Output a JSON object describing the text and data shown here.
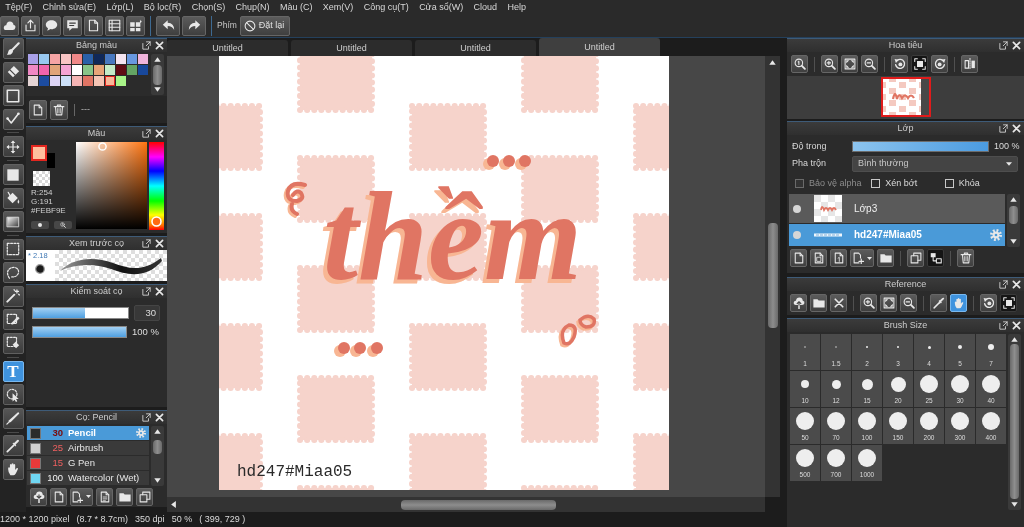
{
  "menu": [
    "Tệp(F)",
    "Chỉnh sửa(E)",
    "Lớp(L)",
    "Bộ lọc(R)",
    "Chọn(S)",
    "Chụp(N)",
    "Màu (C)",
    "Xem(V)",
    "Công cụ(T)",
    "Cửa sổ(W)",
    "Cloud",
    "Help"
  ],
  "toolbar": {
    "shortcut_label": "Phím",
    "reset_button": "Đặt lại"
  },
  "tools": [
    {
      "kind": "brush",
      "selected": false
    },
    {
      "kind": "eraser",
      "selected": false
    },
    {
      "kind": "shape",
      "selected": false
    },
    {
      "kind": "curve",
      "selected": false
    },
    {
      "kind": "move",
      "selected": false
    },
    {
      "kind": "fill",
      "selected": false
    },
    {
      "kind": "bucket",
      "selected": false
    },
    {
      "kind": "gradient",
      "selected": false
    },
    {
      "kind": "select",
      "selected": false
    },
    {
      "kind": "lasso",
      "selected": false
    },
    {
      "kind": "wand",
      "selected": false
    },
    {
      "kind": "select_pen",
      "selected": false
    },
    {
      "kind": "select_eraser",
      "selected": false
    },
    {
      "kind": "text",
      "glyph": "T",
      "selected": true
    },
    {
      "kind": "operation",
      "selected": false
    },
    {
      "kind": "divide",
      "selected": false
    },
    {
      "kind": "eyedropper",
      "selected": false
    },
    {
      "kind": "hand",
      "selected": false
    }
  ],
  "palette": {
    "title": "Bảng màu",
    "swatches": [
      {
        "color": "#a8a0e8",
        "selected": false
      },
      {
        "color": "#98c8f0",
        "selected": false
      },
      {
        "color": "#f4a4a4",
        "selected": false
      },
      {
        "color": "#f8c4c4",
        "selected": false
      },
      {
        "color": "#f08888",
        "selected": false
      },
      {
        "color": "#2a60a8",
        "selected": false
      },
      {
        "color": "#102858",
        "selected": false
      },
      {
        "color": "#4878c0",
        "selected": false
      },
      {
        "color": "#f4e4f0",
        "selected": false
      },
      {
        "color": "#6898e0",
        "selected": false
      },
      {
        "color": "#f0b4dc",
        "selected": false
      },
      {
        "color": "#f088c4",
        "selected": false
      },
      {
        "color": "#f064ac",
        "selected": false
      },
      {
        "color": "#e0a478",
        "selected": false
      },
      {
        "color": "#f4a4d4",
        "selected": false
      },
      {
        "color": "#ffffff",
        "selected": false
      },
      {
        "color": "#88c488",
        "selected": false
      },
      {
        "color": "#e8a478",
        "selected": false
      },
      {
        "color": "#c4ecc8",
        "selected": false
      },
      {
        "color": "#600c14",
        "selected": false
      },
      {
        "color": "#64a464",
        "selected": false
      },
      {
        "color": "#18489c",
        "selected": false
      },
      {
        "color": "#e4d4d4",
        "selected": false
      },
      {
        "color": "#1c4ca0",
        "selected": false
      },
      {
        "color": "#dcd4f4",
        "selected": false
      },
      {
        "color": "#cce0f8",
        "selected": false
      },
      {
        "color": "#f4b4b4",
        "selected": false
      },
      {
        "color": "#e07464",
        "selected": false
      },
      {
        "color": "#f4c4b4",
        "selected": false
      },
      {
        "color": "#f8b898",
        "selected": true
      },
      {
        "color": "#a8f488",
        "selected": false
      }
    ],
    "name": "---"
  },
  "color": {
    "title": "Màu",
    "current": [
      {
        "kind": "foreground",
        "color": "#febf9e",
        "selected": true
      },
      {
        "kind": "background",
        "color": "#000000",
        "selected": false
      }
    ],
    "r": "R:254",
    "g": "G:191",
    "hex": "#FEBF9E",
    "hue": {
      "level": 0.97
    }
  },
  "brush_preview": {
    "title": "Xem trước cọ",
    "size": "* 2.18"
  },
  "brush_control": {
    "title": "Kiểm soát cọ",
    "size": {
      "level": 0.55,
      "value": "30"
    },
    "opacity": {
      "level": 1,
      "reading": "100 %"
    }
  },
  "brushes": {
    "title": "Cọ: Pencil",
    "items": [
      {
        "color": "#2b2b2b",
        "size": "30",
        "size_accent": true,
        "name": "Pencil",
        "selected": true
      },
      {
        "color": "#d0d0d0",
        "size": "25",
        "size_accent": true,
        "name": "Airbrush",
        "selected": false
      },
      {
        "color": "#e83a3a",
        "size": "15",
        "size_accent": true,
        "name": "G Pen",
        "selected": false
      },
      {
        "color": "#6fd6f2",
        "size": "100",
        "size_accent": false,
        "name": "Watercolor (Wet)",
        "selected": false
      }
    ]
  },
  "document_tabs": [
    {
      "title": "Untitled",
      "selected": false
    },
    {
      "title": "Untitled",
      "selected": false
    },
    {
      "title": "Untitled",
      "selected": false
    },
    {
      "title": "Untitled",
      "selected": true
    }
  ],
  "canvas": {
    "lettering": "thềm",
    "signature": "hd247#Miaa05"
  },
  "status_bar": {
    "image_size": "1200 * 1200 pixel",
    "print_size": "(8.7 * 8.7cm)",
    "resolution": "350 dpi",
    "zoom": "50 %",
    "cursor": "( 399, 729 )"
  },
  "navigator": {
    "title": "Hoa tiêu",
    "buttons": [
      {
        "kind": "zoom_reset",
        "pressed": false
      },
      {
        "kind": "zoom_in",
        "pressed": false
      },
      {
        "kind": "fit",
        "pressed": false
      },
      {
        "kind": "zoom_out",
        "pressed": false
      },
      {
        "kind": "rotate_left",
        "pressed": false
      },
      {
        "kind": "actual_size",
        "pressed": true
      },
      {
        "kind": "rotate_right",
        "pressed": false
      },
      {
        "kind": "flip",
        "pressed": false
      }
    ]
  },
  "layers": {
    "title": "Lớp",
    "opacity": {
      "label": "Độ trong",
      "level": 1,
      "reading": "100 %"
    },
    "blend": {
      "label": "Pha trộn",
      "value": "Bình thường"
    },
    "options": [
      {
        "label": "Bảo vệ alpha",
        "checked": false,
        "disabled": true
      },
      {
        "label": "Xén bớt",
        "checked": false,
        "disabled": false
      },
      {
        "label": "Khóa",
        "checked": false,
        "disabled": false
      }
    ],
    "items": [
      {
        "kind": "raster",
        "name": "Lớp3",
        "visible": true,
        "selected": false
      },
      {
        "kind": "text",
        "name": "hd247#Miaa05",
        "visible": true,
        "selected": true
      }
    ],
    "buttons": [
      {
        "kind": "new_layer",
        "pressed": false
      },
      {
        "kind": "new_8bit_layer",
        "pressed": false
      },
      {
        "kind": "new_1bit_layer",
        "pressed": false
      },
      {
        "kind": "add_layer_menu",
        "pressed": false
      },
      {
        "kind": "folder",
        "pressed": false
      },
      {
        "kind": "duplicate",
        "pressed": false
      },
      {
        "kind": "merge",
        "pressed": true
      },
      {
        "kind": "delete",
        "pressed": false
      }
    ]
  },
  "reference": {
    "title": "Reference",
    "buttons": [
      {
        "kind": "import",
        "selected": false,
        "pressed": false
      },
      {
        "kind": "open",
        "selected": false,
        "pressed": false
      },
      {
        "kind": "close",
        "selected": false,
        "pressed": false
      },
      {
        "kind": "zoom_in",
        "selected": false,
        "pressed": false
      },
      {
        "kind": "fit",
        "selected": false,
        "pressed": false
      },
      {
        "kind": "zoom_out",
        "selected": false,
        "pressed": false
      },
      {
        "kind": "eyedropper",
        "selected": false,
        "pressed": false
      },
      {
        "kind": "hand",
        "selected": true,
        "pressed": false
      },
      {
        "kind": "rotate",
        "selected": false,
        "pressed": false
      },
      {
        "kind": "actual_size",
        "selected": false,
        "pressed": true
      }
    ]
  },
  "brush_size": {
    "title": "Brush Size",
    "sizes": [
      "1",
      "1.5",
      "2",
      "3",
      "4",
      "5",
      "7",
      "10",
      "12",
      "15",
      "20",
      "25",
      "30",
      "40",
      "50",
      "70",
      "100",
      "150",
      "200",
      "300",
      "400",
      "500",
      "700",
      "1000"
    ]
  }
}
